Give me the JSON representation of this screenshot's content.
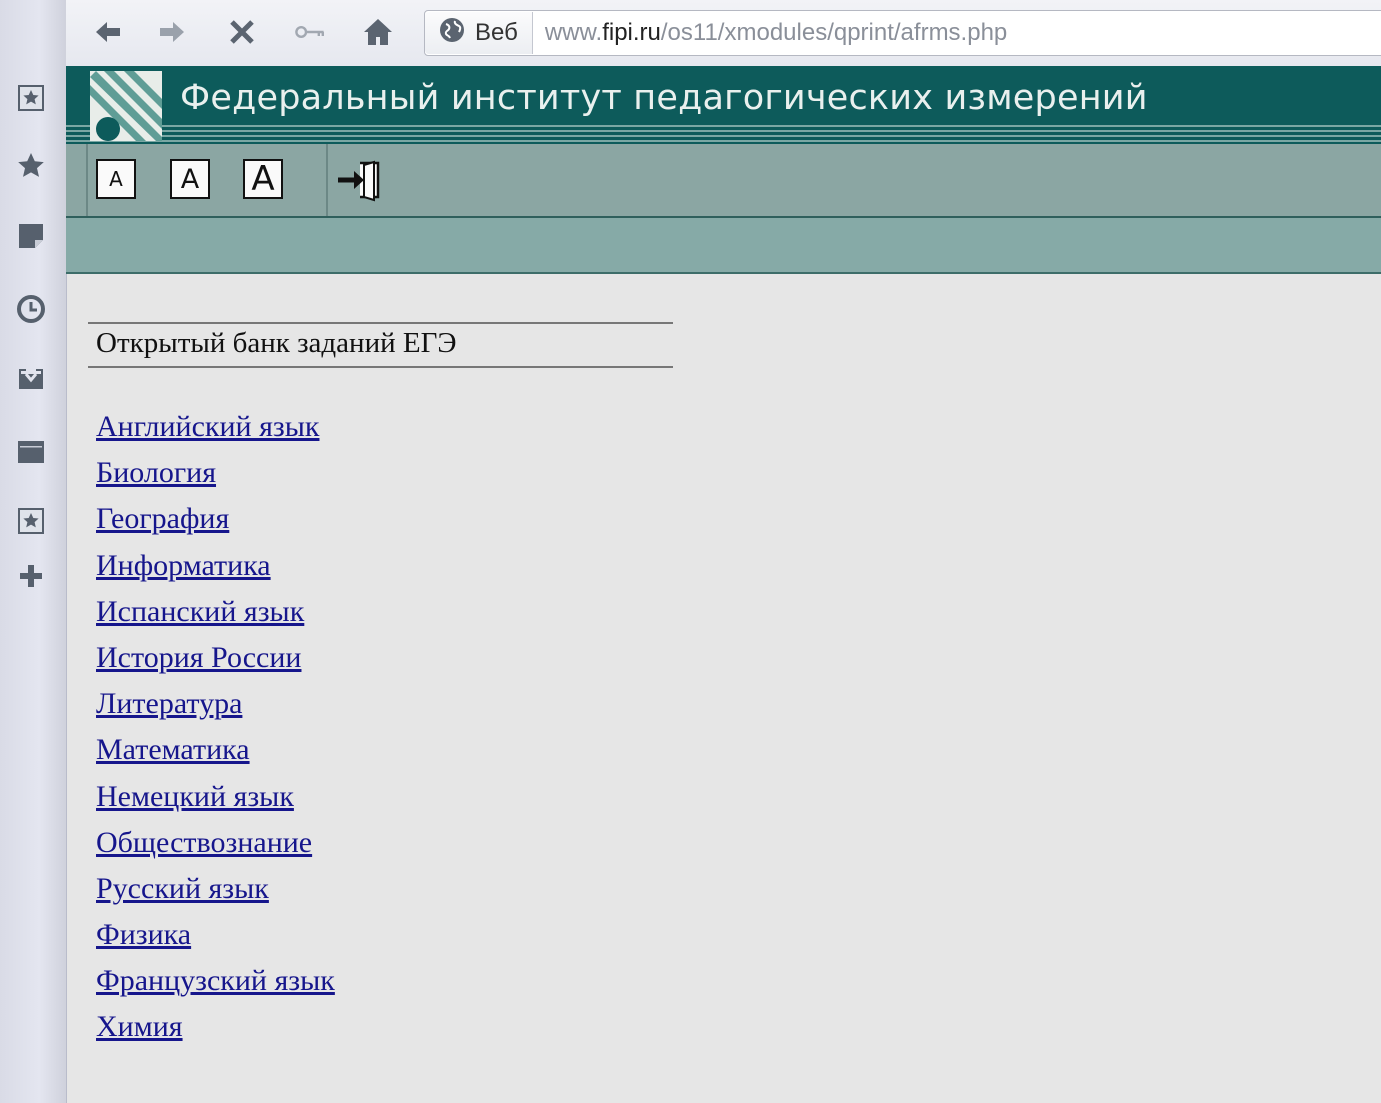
{
  "browser": {
    "url_chip_label": "Веб",
    "url_prefix": "www.",
    "url_host": "fipi.ru",
    "url_path": "/os11/xmodules/qprint/afrms.php",
    "nav_icons": [
      "back-arrow-icon",
      "forward-arrow-icon",
      "stop-icon",
      "key-icon",
      "home-icon"
    ],
    "sidebar_icons": [
      "speed-dial-icon",
      "bookmarks-star-icon",
      "notes-icon",
      "history-clock-icon",
      "downloads-icon",
      "tabs-window-icon",
      "panel-icon",
      "add-panel-icon"
    ]
  },
  "site": {
    "title": "Федеральный институт педагогических измерений",
    "font_buttons": [
      "A",
      "A",
      "A"
    ],
    "colors": {
      "header": "#0d5b5b",
      "tools": "#8ba6a3",
      "link": "#16168c"
    }
  },
  "bank": {
    "title": "Открытый банк заданий ЕГЭ",
    "subjects": [
      "Английский язык",
      "Биология",
      "География",
      "Информатика",
      "Испанский язык",
      "История России",
      "Литература",
      "Математика",
      "Немецкий язык",
      "Обществознание",
      "Русский язык",
      "Физика",
      "Французский язык",
      "Химия"
    ]
  }
}
